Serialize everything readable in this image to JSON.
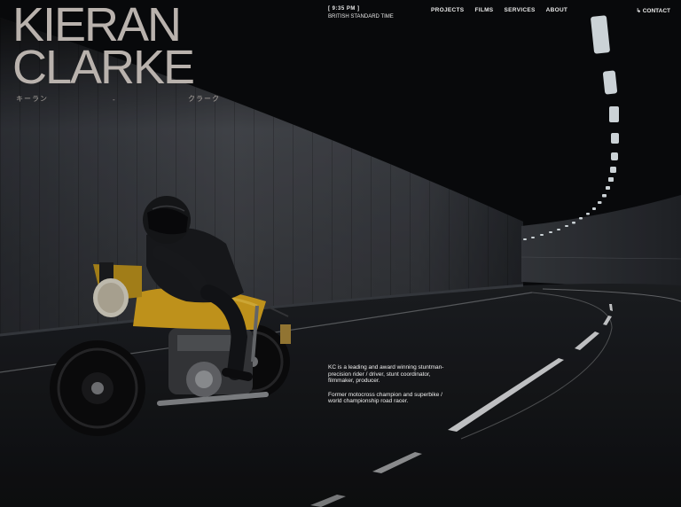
{
  "brand": {
    "line1": "KIERAN",
    "line2": "CLARKE",
    "kana_left": "キーラン",
    "kana_sep": "-",
    "kana_right": "クラーク"
  },
  "clock": {
    "time": "[ 9:35 PM ]",
    "timezone": "BRITISH STANDARD TIME"
  },
  "nav": {
    "items": [
      "PROJECTS",
      "FILMS",
      "SERVICES",
      "ABOUT"
    ],
    "contact": "↳ CONTACT"
  },
  "bio": {
    "p1": "KC is a leading and award winning stuntman-precision rider / driver, stunt coordinator, filmmaker, producer.",
    "p2": "Former motocross champion and superbike / world championship road racer."
  },
  "colors": {
    "brand_text": "#b9b2ad",
    "nav_text": "#e9e9e9",
    "bike_yellow": "#d9a51f"
  }
}
